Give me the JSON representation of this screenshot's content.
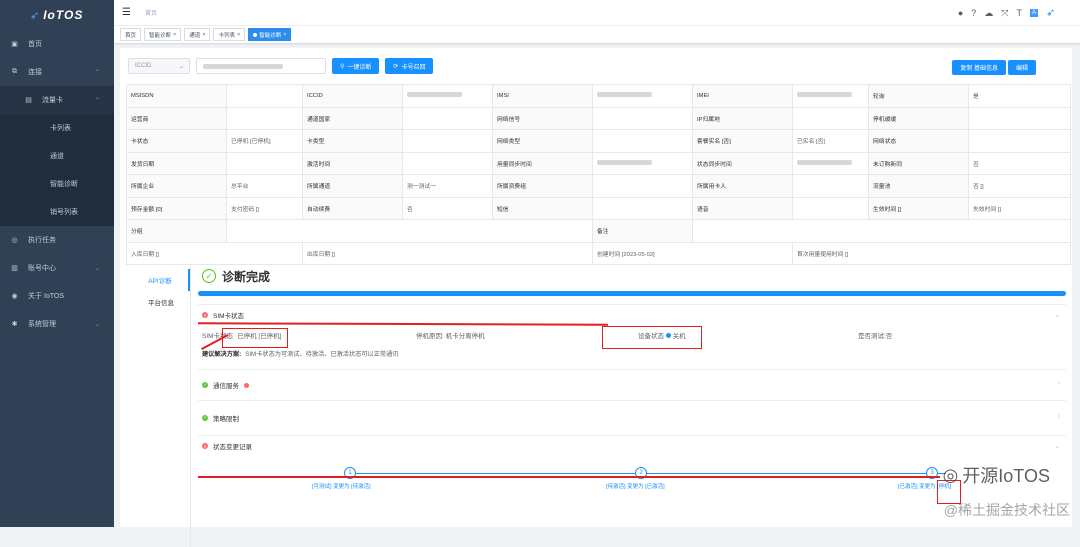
{
  "app": {
    "logo": "IoTOS"
  },
  "sidebar": {
    "items": [
      {
        "label": "首页",
        "icon": "dashboard-icon"
      },
      {
        "label": "连接",
        "icon": "link-icon"
      },
      {
        "label": "流量卡",
        "icon": "sim-icon"
      },
      {
        "label": "卡列表"
      },
      {
        "label": "通道"
      },
      {
        "label": "智能诊断"
      },
      {
        "label": "销号列表"
      },
      {
        "label": "执行任务",
        "icon": "task-icon"
      },
      {
        "label": "账号中心",
        "icon": "account-icon"
      },
      {
        "label": "关于 IoTOS",
        "icon": "info-icon"
      },
      {
        "label": "系统管理",
        "icon": "gear-icon"
      }
    ]
  },
  "navbar": {
    "breadcrumb": "首页"
  },
  "tags": [
    "首页",
    "智能诊断",
    "通道",
    "卡列表",
    "智能诊断"
  ],
  "toolbar": {
    "select": "ICCID",
    "diag_btn": "一键诊断",
    "card_btn": "卡号召回",
    "right_btn1": "复制 基础信息",
    "right_btn2": "编辑"
  },
  "info": {
    "rows": [
      [
        "MSISDN",
        "",
        "ICCID",
        "",
        "IMSI",
        "",
        "IMEI",
        "",
        "轮询",
        "是"
      ],
      [
        "运营商",
        "",
        "通道国家",
        "",
        "网络信号",
        "",
        "IP归属地",
        "",
        "停机缓缓",
        ""
      ],
      [
        "卡状态",
        "已停机 [已停机]",
        "卡类型",
        "",
        "网络类型",
        "",
        "套餐实名 [否]",
        "已实名 [否]",
        "网络状态",
        ""
      ],
      [
        "发货日期",
        "",
        "激活时间",
        "",
        "用量同步时间",
        "",
        "状态同步时间",
        "",
        "未订购新同",
        "否"
      ],
      [
        "所属企业",
        "总平台",
        "所属通道",
        "测一测试一",
        "所属资费组",
        "",
        "所属用卡人",
        "",
        "流量池",
        "否 []"
      ],
      [
        "预存金额 [0]",
        "支付密码 []",
        "自动续费",
        "否",
        "短信",
        "",
        "语音",
        "",
        "生效时间 []",
        "失效时间 []"
      ]
    ],
    "row_remark": [
      "分组",
      "",
      "备注",
      ""
    ],
    "row_dates": [
      "入库日期 []",
      "出库日期 []",
      "创建时间 [2023-05-02]",
      "首次用量使用时间 []"
    ]
  },
  "vtabs": [
    "API诊断",
    "平台信息"
  ],
  "diag": {
    "title": "诊断完成",
    "sim_section": "SIM卡状态",
    "sim_status_label": "SIM卡状态",
    "sim_status_value": "已停机 [已停机]",
    "stop_reason": "停机原因: 机卡分离停机",
    "device_label": "设备状态",
    "device_value": "关机",
    "test_label": "是否测试:否",
    "advice_label": "建议解决方案:",
    "advice_text": "SIM卡状态为可测试、待激活、已激活状态可以正常通讯",
    "comm_section": "通信服务",
    "policy_section": "策略限制",
    "history_section": "状态变更记录",
    "timeline": [
      {
        "n": "1",
        "text": "[可测试] 变更为 [待激活]"
      },
      {
        "n": "2",
        "text": "[待激活] 变更为 [已激活]"
      },
      {
        "n": "3",
        "text": "[已激活] 变更为 [停机]"
      }
    ]
  },
  "watermark": {
    "line1": "开源IoTOS",
    "line2": "@稀土掘金技术社区"
  }
}
